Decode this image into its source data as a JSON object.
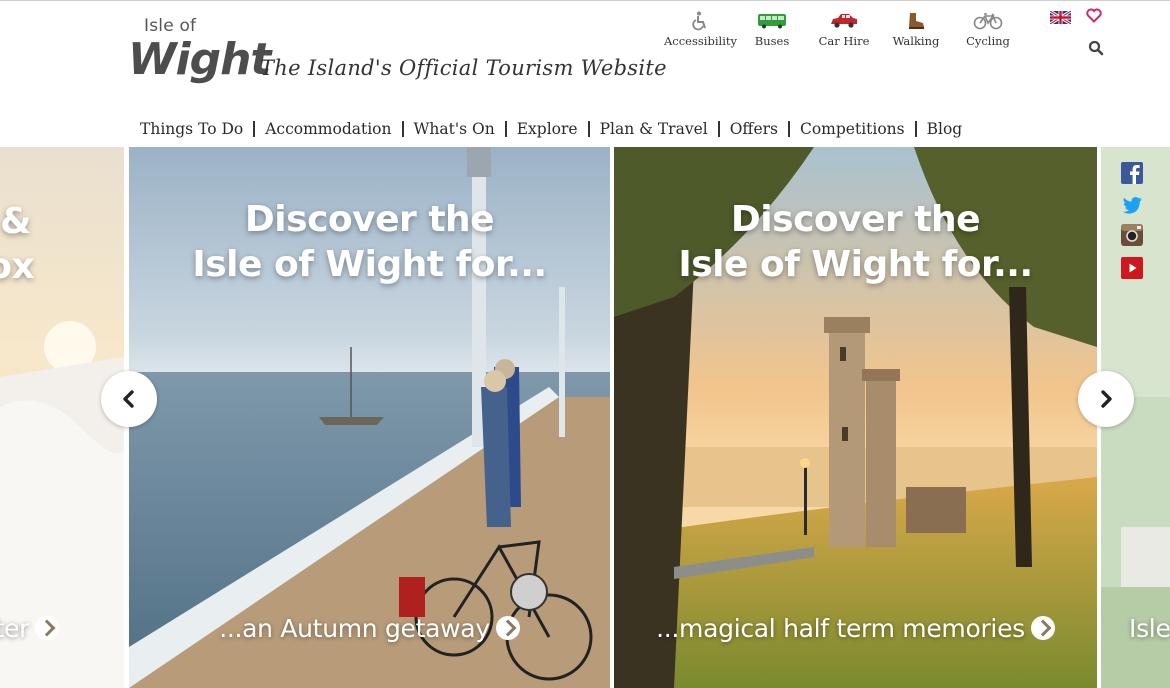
{
  "brand": {
    "logo_small": "Isle of",
    "logo_big": "Wight",
    "tagline": "The Island's Official Tourism Website"
  },
  "utilities": [
    {
      "label": "Accessibility",
      "icon": "wheelchair-icon",
      "color": "#888888"
    },
    {
      "label": "Buses",
      "icon": "bus-icon",
      "color": "#2e9e3a"
    },
    {
      "label": "Car Hire",
      "icon": "car-icon",
      "color": "#c0272d"
    },
    {
      "label": "Walking",
      "icon": "boot-icon",
      "color": "#8a5a2b"
    },
    {
      "label": "Cycling",
      "icon": "bicycle-icon",
      "color": "#888888"
    }
  ],
  "header_icons": {
    "language": "uk-flag-icon",
    "favourites": "heart-icon",
    "search": "search-icon",
    "heart_color": "#d6246e"
  },
  "nav": [
    "Things To Do",
    "Accommodation",
    "What's On",
    "Explore",
    "Plan & Travel",
    "Offers",
    "Competitions",
    "Blog"
  ],
  "slides": {
    "left_partial": {
      "heading_line1": "&",
      "heading_line2": "box",
      "cta": "tter"
    },
    "slide1": {
      "heading_line1": "Discover the",
      "heading_line2": "Isle of Wight for...",
      "cta": "...an Autumn getaway"
    },
    "slide2": {
      "heading_line1": "Discover the",
      "heading_line2": "Isle of Wight for...",
      "cta": "...magical half term memories"
    },
    "right_partial": {
      "cta": "Isle"
    }
  },
  "carousel_controls": {
    "prev": "chevron-left-icon",
    "next": "chevron-right-icon"
  },
  "social": [
    "facebook-icon",
    "twitter-icon",
    "instagram-icon",
    "youtube-icon"
  ]
}
